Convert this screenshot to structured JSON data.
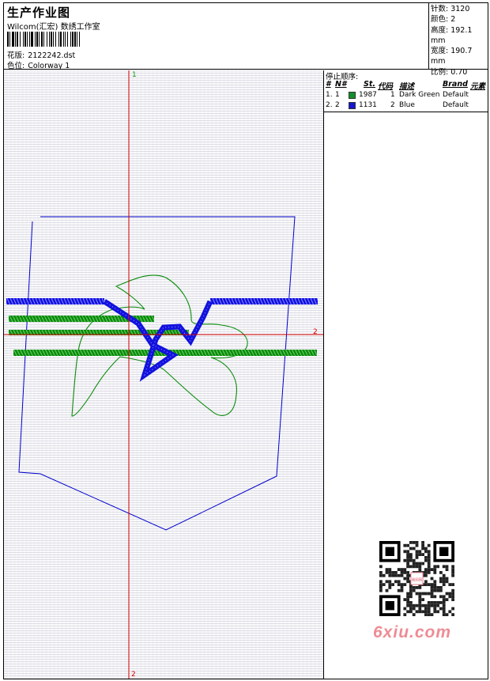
{
  "header": {
    "title": "生产作业图",
    "company": "Wilcom(汇宏) 数绣工作室",
    "design_label": "花版:",
    "design_value": "2122242.dst",
    "colorway_label": "色位:",
    "colorway_value": "Colorway 1"
  },
  "stats": [
    {
      "label": "针数:",
      "value": "3120"
    },
    {
      "label": "颜色:",
      "value": "2"
    },
    {
      "label": "高度:",
      "value": "192.1 mm"
    },
    {
      "label": "宽度:",
      "value": "190.7 mm"
    },
    {
      "label": "比例:",
      "value": "0.70"
    }
  ],
  "canvas": {
    "axis_labels": {
      "top": "1",
      "right": "2",
      "bottom": "2"
    },
    "colors": {
      "axis": "#d40000",
      "outline": "#0000cc",
      "green": "#0b8c0b",
      "blue": "#1414e6",
      "axis_top_label": "#10a010"
    }
  },
  "stop_sequence": {
    "title": "停止顺序:",
    "headers": [
      "#",
      "N#",
      "St.",
      "代码",
      "描述",
      "Brand",
      "元素"
    ],
    "rows": [
      {
        "index": "1.",
        "n": "1",
        "color": "#11902a",
        "stitches": "1987",
        "code": "1",
        "description": "Dark Green",
        "brand": "Default"
      },
      {
        "index": "2.",
        "n": "2",
        "color": "#1616d0",
        "stitches": "1131",
        "code": "2",
        "description": "Blue",
        "brand": "Default"
      }
    ]
  },
  "watermark": {
    "qr_center_text": "我图网",
    "brand_text": "6xiu.com",
    "brand_color": "#ee8c95"
  }
}
